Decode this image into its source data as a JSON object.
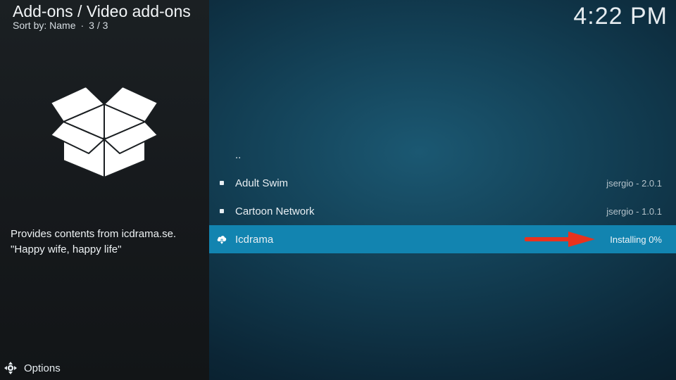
{
  "header": {
    "title": "Add-ons / Video add-ons",
    "sort_label": "Sort by: Name",
    "position": "3 / 3"
  },
  "clock": "4:22 PM",
  "detail": {
    "icon": "open-box-icon",
    "description_line1": "Provides contents from icdrama.se.",
    "description_line2": "\"Happy wife, happy life\""
  },
  "footer": {
    "options_label": "Options",
    "options_icon": "options-gear-icon"
  },
  "list": {
    "items": [
      {
        "label": "..",
        "meta": ""
      },
      {
        "label": "Adult Swim",
        "meta": "jsergio - 2.0.1",
        "icon": "bullet-icon"
      },
      {
        "label": "Cartoon Network",
        "meta": "jsergio - 1.0.1",
        "icon": "bullet-icon"
      },
      {
        "label": "Icdrama",
        "meta": "Installing 0%",
        "icon": "cloud-download-icon",
        "selected": true,
        "install_progress": 0
      }
    ]
  },
  "colors": {
    "selection": "#1284b0",
    "annotation_arrow": "#e8321e"
  }
}
